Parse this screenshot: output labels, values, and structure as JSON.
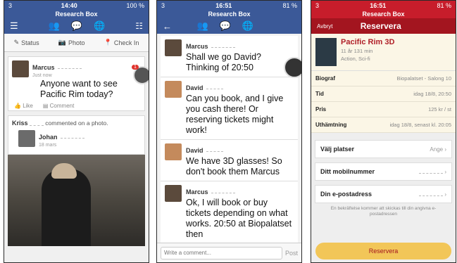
{
  "status": {
    "p1": {
      "carrier": "3",
      "time": "14:40",
      "battery": "100 %"
    },
    "p2": {
      "carrier": "3",
      "time": "16:51",
      "battery": "81 %"
    },
    "p3": {
      "carrier": "3",
      "time": "16:51",
      "battery": "81 %"
    }
  },
  "app_title": "Research Box",
  "feed": {
    "actions": [
      "Status",
      "Photo",
      "Check In"
    ],
    "post": {
      "author": "Marcus",
      "time": "Just now",
      "text": "Anyone want to see Pacific Rim today?",
      "like": "Like",
      "comment": "Comment"
    },
    "notif_count": "1",
    "activity": {
      "author": "Kriss",
      "action": "commented on a photo."
    },
    "photo_author": {
      "name": "Johan",
      "time": "18 mars"
    }
  },
  "chat": {
    "messages": [
      {
        "author": "Marcus",
        "text": "Shall we go David? Thinking of 20:50"
      },
      {
        "author": "David",
        "text": "Can you book, and I give you cash there! Or reserving tickets might work!"
      },
      {
        "author": "David",
        "text": "We have 3D glasses! So don't book them Marcus"
      },
      {
        "author": "Marcus",
        "text": "Ok, I will book or buy tickets depending on what works. 20:50 at Biopalatset then"
      }
    ],
    "composer_placeholder": "Write a comment...",
    "post_label": "Post"
  },
  "booking": {
    "cancel": "Avbryt",
    "title": "Reservera",
    "movie": {
      "title": "Pacific Rim 3D",
      "meta": "11 år  131 min",
      "genre": "Action, Sci-fi"
    },
    "info": [
      {
        "key": "Biograf",
        "value": "Biopalatset - Salong 10"
      },
      {
        "key": "Tid",
        "value": "idag 18/8, 20:50"
      },
      {
        "key": "Pris",
        "value": "125 kr / st"
      },
      {
        "key": "Uthämtning",
        "value": "idag 18/8, senast kl. 20:05"
      }
    ],
    "options": [
      {
        "key": "Välj platser",
        "value": "Ange"
      },
      {
        "key": "Ditt mobilnummer",
        "value": ""
      },
      {
        "key": "Din e-postadress",
        "value": ""
      }
    ],
    "note": "En bekräftelse kommer att skickas till din angivna e-postadressen",
    "submit": "Reservera"
  }
}
